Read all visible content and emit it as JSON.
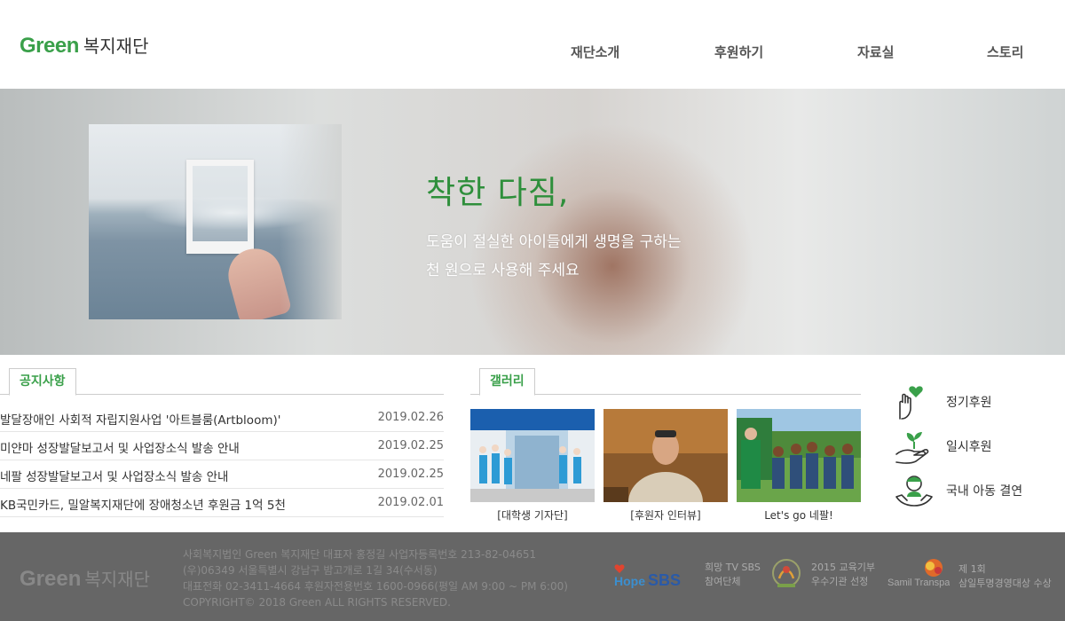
{
  "header": {
    "logo_en": "Green",
    "logo_kr": "복지재단",
    "nav": [
      "재단소개",
      "후원하기",
      "자료실",
      "스토리"
    ]
  },
  "hero": {
    "title": "착한 다짐,",
    "line1": "도움이 절실한 아이들에게 생명을 구하는",
    "line2": "천 원으로 사용해 주세요"
  },
  "notices": {
    "tab": "공지사항",
    "items": [
      {
        "title": "발달장애인 사회적 자립지원사업 '아트블룸(Artbloom)'",
        "date": "2019.02.26"
      },
      {
        "title": "미얀마 성장발달보고서 및 사업장소식 발송 안내",
        "date": "2019.02.25"
      },
      {
        "title": "네팔 성장발달보고서 및 사업장소식 발송 안내",
        "date": "2019.02.25"
      },
      {
        "title": "KB국민카드, 밀알복지재단에 장애청소년 후원금 1억 5천",
        "date": "2019.02.01"
      }
    ]
  },
  "gallery": {
    "tab": "갤러리",
    "items": [
      {
        "caption": "[대학생 기자단]"
      },
      {
        "caption": "[후원자 인터뷰]"
      },
      {
        "caption": "Let's go 네팔!"
      }
    ]
  },
  "donations": [
    {
      "label": "정기후원",
      "icon": "hand-heart-icon"
    },
    {
      "label": "일시후원",
      "icon": "hand-sprout-icon"
    },
    {
      "label": "국내 아동 결연",
      "icon": "hand-child-icon"
    }
  ],
  "footer": {
    "logo_en": "Green",
    "logo_kr": "복지재단",
    "info": [
      "사회복지법인 Green 복지재단 대표자 홍정길 사업자등록번호 213-82-04651",
      "(우)06349 서울특별시 강남구 밤고개로 1길 34(수서동)",
      "대표전화 02-3411-4664 후원자전용번호 1600-0966(평일 AM 9:00 ~ PM 6:00)",
      "COPYRIGHT© 2018 Green ALL RIGHTS RESERVED."
    ],
    "awards": [
      {
        "logo": "SBS",
        "line1": "희망 TV SBS",
        "line2": "참여단체"
      },
      {
        "logo": "",
        "line1": "2015 교육기부",
        "line2": "우수기관 선정"
      },
      {
        "logo": "Samil Transparency",
        "line1": "제 1회",
        "line2": "삼일투명경영대상 수상"
      }
    ]
  },
  "colors": {
    "brand_green": "#3aa04a",
    "hero_title": "#2e8f3b",
    "footer_bg": "#666666"
  }
}
